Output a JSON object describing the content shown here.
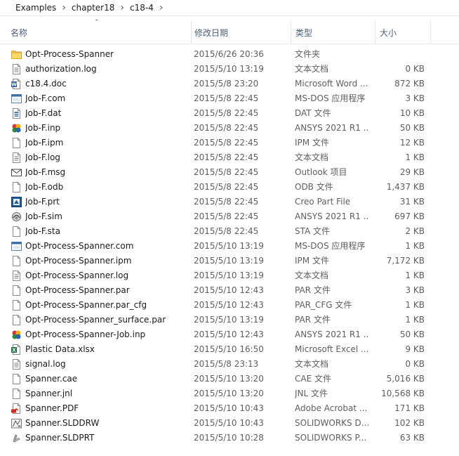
{
  "breadcrumb": [
    "Examples",
    "chapter18",
    "c18-4"
  ],
  "columns": {
    "name": "名称",
    "date": "修改日期",
    "type": "类型",
    "size": "大小"
  },
  "files": [
    {
      "name": "Opt-Process-Spanner",
      "date": "2015/6/26 20:36",
      "type": "文件夹",
      "size": "",
      "icon": "folder-icon"
    },
    {
      "name": "authorization.log",
      "date": "2015/5/10 13:19",
      "type": "文本文档",
      "size": "0 KB",
      "icon": "text-file-icon"
    },
    {
      "name": "c18.4.doc",
      "date": "2015/5/8 23:20",
      "type": "Microsoft Word ...",
      "size": "872 KB",
      "icon": "word-icon"
    },
    {
      "name": "Job-F.com",
      "date": "2015/5/8 22:45",
      "type": "MS-DOS 应用程序",
      "size": "3 KB",
      "icon": "app-icon"
    },
    {
      "name": "Job-F.dat",
      "date": "2015/5/8 22:45",
      "type": "DAT 文件",
      "size": "10 KB",
      "icon": "dat-icon"
    },
    {
      "name": "Job-F.inp",
      "date": "2015/5/8 22:45",
      "type": "ANSYS 2021 R1 ...",
      "size": "50 KB",
      "icon": "ansys-icon"
    },
    {
      "name": "Job-F.ipm",
      "date": "2015/5/8 22:45",
      "type": "IPM 文件",
      "size": "12 KB",
      "icon": "blank-file-icon"
    },
    {
      "name": "Job-F.log",
      "date": "2015/5/8 22:45",
      "type": "文本文档",
      "size": "1 KB",
      "icon": "text-file-icon"
    },
    {
      "name": "Job-F.msg",
      "date": "2015/5/8 22:45",
      "type": "Outlook 项目",
      "size": "29 KB",
      "icon": "mail-icon"
    },
    {
      "name": "Job-F.odb",
      "date": "2015/5/8 22:45",
      "type": "ODB 文件",
      "size": "1,437 KB",
      "icon": "blank-file-icon"
    },
    {
      "name": "Job-F.prt",
      "date": "2015/5/8 22:45",
      "type": "Creo Part File",
      "size": "31 KB",
      "icon": "creo-icon"
    },
    {
      "name": "Job-F.sim",
      "date": "2015/5/8 22:45",
      "type": "ANSYS 2021 R1 ...",
      "size": "697 KB",
      "icon": "sim-icon"
    },
    {
      "name": "Job-F.sta",
      "date": "2015/5/8 22:45",
      "type": "STA 文件",
      "size": "2 KB",
      "icon": "blank-file-icon"
    },
    {
      "name": "Opt-Process-Spanner.com",
      "date": "2015/5/10 13:19",
      "type": "MS-DOS 应用程序",
      "size": "1 KB",
      "icon": "app-icon"
    },
    {
      "name": "Opt-Process-Spanner.ipm",
      "date": "2015/5/10 13:19",
      "type": "IPM 文件",
      "size": "7,172 KB",
      "icon": "blank-file-icon"
    },
    {
      "name": "Opt-Process-Spanner.log",
      "date": "2015/5/10 13:19",
      "type": "文本文档",
      "size": "1 KB",
      "icon": "text-file-icon"
    },
    {
      "name": "Opt-Process-Spanner.par",
      "date": "2015/5/10 12:43",
      "type": "PAR 文件",
      "size": "3 KB",
      "icon": "blank-file-icon"
    },
    {
      "name": "Opt-Process-Spanner.par_cfg",
      "date": "2015/5/10 12:43",
      "type": "PAR_CFG 文件",
      "size": "1 KB",
      "icon": "blank-file-icon"
    },
    {
      "name": "Opt-Process-Spanner_surface.par",
      "date": "2015/5/10 13:19",
      "type": "PAR 文件",
      "size": "1 KB",
      "icon": "blank-file-icon"
    },
    {
      "name": "Opt-Process-Spanner-Job.inp",
      "date": "2015/5/10 12:43",
      "type": "ANSYS 2021 R1 ...",
      "size": "50 KB",
      "icon": "ansys-icon"
    },
    {
      "name": "Plastic Data.xlsx",
      "date": "2015/5/10 16:50",
      "type": "Microsoft Excel ...",
      "size": "9 KB",
      "icon": "excel-icon"
    },
    {
      "name": "signal.log",
      "date": "2015/5/8 23:13",
      "type": "文本文档",
      "size": "0 KB",
      "icon": "text-file-icon"
    },
    {
      "name": "Spanner.cae",
      "date": "2015/5/10 13:20",
      "type": "CAE 文件",
      "size": "5,016 KB",
      "icon": "blank-file-icon"
    },
    {
      "name": "Spanner.jnl",
      "date": "2015/5/10 13:20",
      "type": "JNL 文件",
      "size": "10,568 KB",
      "icon": "blank-file-icon"
    },
    {
      "name": "Spanner.PDF",
      "date": "2015/5/10 10:43",
      "type": "Adobe Acrobat ...",
      "size": "171 KB",
      "icon": "pdf-icon"
    },
    {
      "name": "Spanner.SLDDRW",
      "date": "2015/5/10 10:43",
      "type": "SOLIDWORKS D...",
      "size": "102 KB",
      "icon": "solidworks-drawing-icon"
    },
    {
      "name": "Spanner.SLDPRT",
      "date": "2015/5/10 10:28",
      "type": "SOLIDWORKS P...",
      "size": "63 KB",
      "icon": "solidworks-part-icon"
    }
  ]
}
